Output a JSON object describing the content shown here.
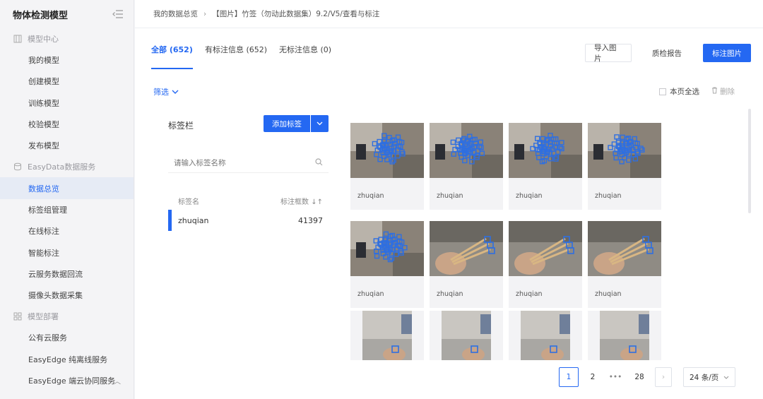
{
  "sidebar": {
    "title": "物体检测模型",
    "groups": [
      {
        "label": "模型中心",
        "items": [
          "我的模型",
          "创建模型",
          "训练模型",
          "校验模型",
          "发布模型"
        ]
      },
      {
        "label": "EasyData数据服务",
        "items": [
          "数据总览",
          "标签组管理",
          "在线标注",
          "智能标注",
          "云服务数据回流",
          "摄像头数据采集"
        ]
      },
      {
        "label": "模型部署",
        "items": [
          "公有云服务",
          "EasyEdge 纯离线服务",
          "EasyEdge 端云协同服务"
        ]
      }
    ]
  },
  "breadcrumb": {
    "root": "我的数据总览",
    "current": "【图片】竹签（勿动此数据集）9.2/V5/查看与标注"
  },
  "tabs": [
    {
      "label": "全部 (652)"
    },
    {
      "label": "有标注信息 (652)"
    },
    {
      "label": "无标注信息 (0)"
    }
  ],
  "actions": {
    "import": "导入图片",
    "quality": "质检报告",
    "annotate": "标注图片"
  },
  "filter_label": "筛选",
  "select_all": "本页全选",
  "delete": "删除",
  "label_panel": {
    "title": "标签栏",
    "add_button": "添加标签",
    "search_placeholder": "请输入标签名称",
    "col_name": "标签名",
    "col_count": "标注框数",
    "rows": [
      {
        "name": "zhuqian",
        "count": "41397"
      }
    ]
  },
  "images": [
    {
      "caption": "zhuqian",
      "kind": "cluster"
    },
    {
      "caption": "zhuqian",
      "kind": "cluster"
    },
    {
      "caption": "zhuqian",
      "kind": "cluster"
    },
    {
      "caption": "zhuqian",
      "kind": "cluster"
    },
    {
      "caption": "zhuqian",
      "kind": "cluster"
    },
    {
      "caption": "zhuqian",
      "kind": "handheld"
    },
    {
      "caption": "zhuqian",
      "kind": "handheld"
    },
    {
      "caption": "zhuqian",
      "kind": "handheld"
    },
    {
      "caption": "",
      "kind": "photo"
    },
    {
      "caption": "",
      "kind": "photo"
    },
    {
      "caption": "",
      "kind": "photo"
    },
    {
      "caption": "",
      "kind": "photo"
    }
  ],
  "pagination": {
    "pages": [
      "1",
      "2",
      "•••",
      "28"
    ],
    "current": "1",
    "page_size": "24 条/页"
  },
  "colors": {
    "accent": "#2468f2",
    "annotation": "#2f6fe0"
  }
}
